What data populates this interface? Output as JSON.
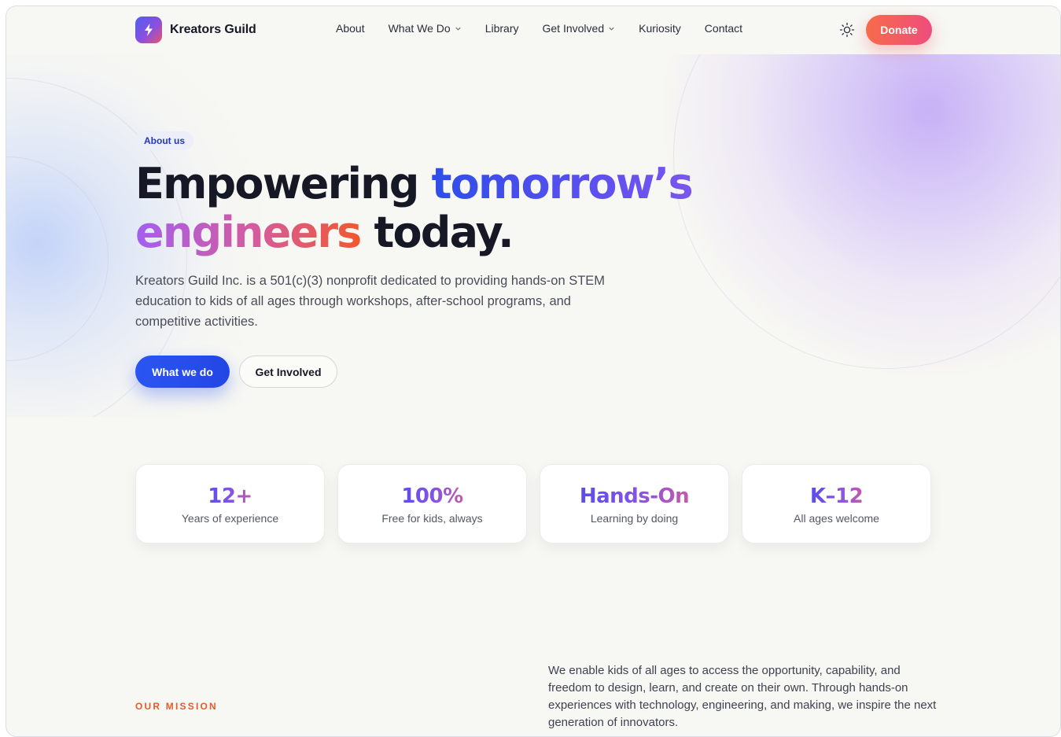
{
  "header": {
    "logo_name": "Kreators Guild",
    "nav": [
      {
        "label": "About",
        "has_dropdown": false
      },
      {
        "label": "What We Do",
        "has_dropdown": true
      },
      {
        "label": "Library",
        "has_dropdown": false
      },
      {
        "label": "Get Involved",
        "has_dropdown": true
      },
      {
        "label": "Kuriosity",
        "has_dropdown": false
      },
      {
        "label": "Contact",
        "has_dropdown": false
      }
    ],
    "theme_icon": "sun-icon",
    "donate_label": "Donate"
  },
  "hero": {
    "badge": "About us",
    "headline": {
      "part1": "Empowering ",
      "part2": "tomorrow’s",
      "part3": "engineers",
      "part4": " today."
    },
    "description": "Kreators Guild Inc. is a 501(c)(3) nonprofit dedicated to providing hands-on STEM education to kids of all ages through workshops, after-school programs, and competitive activities.",
    "primary_cta": "What we do",
    "secondary_cta": "Get Involved"
  },
  "stats": [
    {
      "value": "12+",
      "label": "Years of experience"
    },
    {
      "value": "100%",
      "label": "Free for kids, always"
    },
    {
      "value": "Hands-On",
      "label": "Learning by doing"
    },
    {
      "value": "K–12",
      "label": "All ages welcome"
    }
  ],
  "mission": {
    "label": "OUR MISSION",
    "text": "We enable kids of all ages to access the opportunity, capability, and freedom to design, learn, and create on their own. Through hands-on experiences with technology, engineering, and making, we inspire the next generation of innovators."
  },
  "colors": {
    "primary_blue": "#2b55f2",
    "donate_gradient_start": "#f76b4a",
    "donate_gradient_end": "#ee4d7c",
    "mission_label": "#ea5a28",
    "badge_text": "#2438b8"
  }
}
